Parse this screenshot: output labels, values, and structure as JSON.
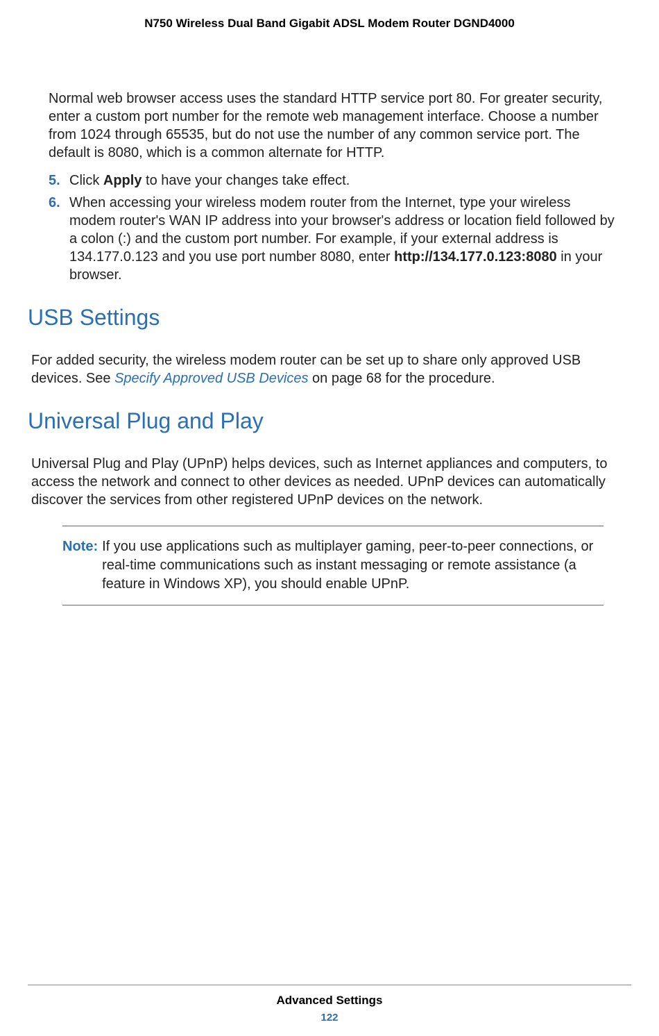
{
  "header": {
    "title": "N750 Wireless Dual Band Gigabit ADSL Modem Router DGND4000"
  },
  "intro_paragraph": "Normal web browser access uses the standard HTTP service port 80. For greater security, enter a custom port number for the remote web management interface. Choose a number from 1024 through 65535, but do not use the number of any common service port. The default is 8080, which is a common alternate for HTTP.",
  "list": {
    "item5": {
      "num": "5.",
      "prefix": "Click ",
      "bold": "Apply",
      "suffix": " to have your changes take effect."
    },
    "item6": {
      "num": "6.",
      "prefix": "When accessing your wireless modem router from the Internet, type your wireless modem router's WAN IP address into your browser's address or location field followed by a colon (:) and the custom port number. For example, if your external address is 134.177.0.123 and you use port number 8080, enter ",
      "bold": "http://134.177.0.123:8080",
      "suffix": " in your browser."
    }
  },
  "usb": {
    "heading": "USB Settings",
    "para_prefix": "For added security, the wireless modem router can be set up to share only approved USB devices. See ",
    "link_text": "Specify Approved USB Devices",
    "para_suffix": " on page 68 for the procedure."
  },
  "upnp": {
    "heading": "Universal Plug and Play",
    "para": "Universal Plug and Play (UPnP) helps devices, such as Internet appliances and computers, to access the network and connect to other devices as needed. UPnP devices can automatically discover the services from other registered UPnP devices on the network.",
    "note_label": "Note:",
    "note_text": "If you use applications such as multiplayer gaming, peer-to-peer connections, or real-time communications such as instant messaging or remote assistance (a feature in Windows XP), you should enable UPnP."
  },
  "footer": {
    "section": "Advanced Settings",
    "page": "122"
  }
}
